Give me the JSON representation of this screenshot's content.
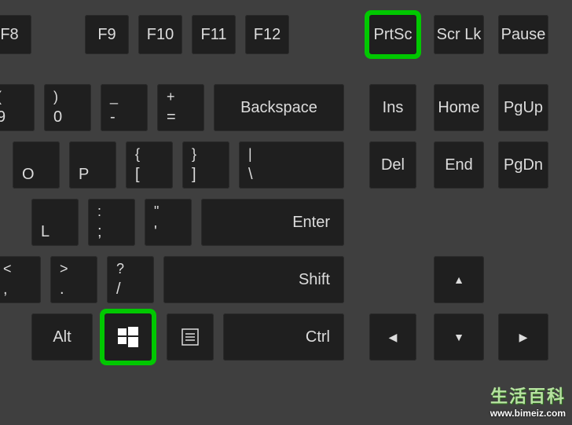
{
  "keys": {
    "f8": "F8",
    "f9": "F9",
    "f10": "F10",
    "f11": "F11",
    "f12": "F12",
    "prtsc": "PrtSc",
    "scrlk": "Scr Lk",
    "pause": "Pause",
    "nine_top": "(",
    "nine_bottom": "9",
    "zero_top": ")",
    "zero_bottom": "0",
    "minus_top": "_",
    "minus_bottom": "-",
    "equals_top": "+",
    "equals_bottom": "=",
    "backspace": "Backspace",
    "ins": "Ins",
    "home": "Home",
    "pgup": "PgUp",
    "del": "Del",
    "end": "End",
    "pgdn": "PgDn",
    "o": "O",
    "p": "P",
    "lbracket_top": "{",
    "lbracket_bottom": "[",
    "rbracket_top": "}",
    "rbracket_bottom": "]",
    "backslash_top": "|",
    "backslash_bottom": "\\",
    "l": "L",
    "semicolon_top": ":",
    "semicolon_bottom": ";",
    "quote_top": "\"",
    "quote_bottom": "'",
    "enter": "Enter",
    "comma_top": "<",
    "comma_bottom": ",",
    "period_top": ">",
    "period_bottom": ".",
    "slash_top": "?",
    "slash_bottom": "/",
    "shift": "Shift",
    "alt": "Alt",
    "ctrl": "Ctrl",
    "arrow_up": "▲",
    "arrow_left": "◀",
    "arrow_down": "▼",
    "arrow_right": "▶"
  },
  "watermark": {
    "line1": "生活百科",
    "line2": "www.bimeiz.com"
  },
  "colors": {
    "highlight": "#00c800",
    "key_bg": "#1f1f1f",
    "board_bg": "#3f3f3f",
    "text": "#dcdcdc"
  }
}
